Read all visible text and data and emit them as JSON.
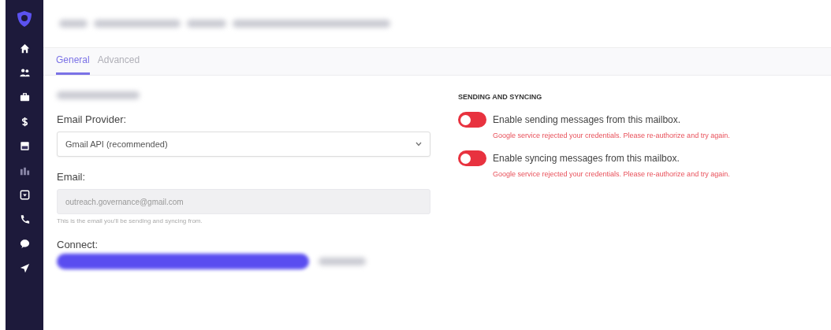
{
  "sidebar": {
    "items": [
      {
        "selected": false
      },
      {
        "selected": false
      },
      {
        "selected": false
      },
      {
        "selected": false
      },
      {
        "selected": false
      },
      {
        "selected": false
      },
      {
        "selected": false
      },
      {
        "selected": false
      },
      {
        "selected": false
      },
      {
        "selected": false
      }
    ]
  },
  "tabs": [
    {
      "label": "General",
      "selected": true
    },
    {
      "label": "Advanced",
      "selected": false
    }
  ],
  "form": {
    "provider": {
      "label": "Email Provider:",
      "value": "Gmail API (recommended)"
    },
    "email": {
      "label": "Email:",
      "value": "outreach.governance@gmail.com",
      "help": "This is the email you'll be sending and syncing from."
    },
    "connect": {
      "label": "Connect:"
    }
  },
  "sending_and_syncing": {
    "heading": "SENDING AND SYNCING",
    "toggles": [
      {
        "label": "Enable sending messages from this mailbox.",
        "on": false,
        "error": "Google service rejected your credentials. Please re-authorize and try again."
      },
      {
        "label": "Enable syncing messages from this mailbox.",
        "on": false,
        "error": "Google service rejected your credentials. Please re-authorize and try again."
      }
    ]
  }
}
